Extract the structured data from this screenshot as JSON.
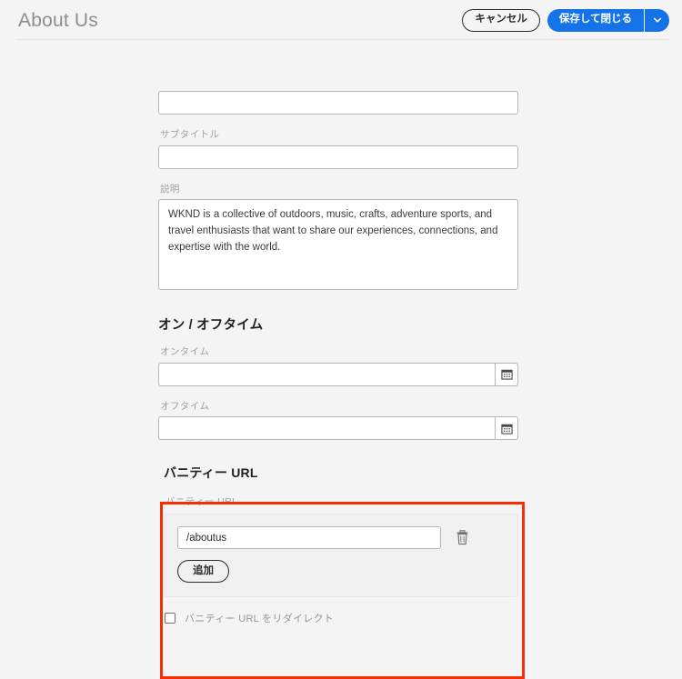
{
  "header": {
    "title": "About Us",
    "cancel_label": "キャンセル",
    "save_label": "保存して閉じる",
    "caret_icon": "chevron-down-icon",
    "accent_color": "#1473e6"
  },
  "form": {
    "title_field": {
      "label": "",
      "value": "",
      "placeholder": ""
    },
    "subtitle_field": {
      "label": "サブタイトル",
      "value": "",
      "placeholder": ""
    },
    "description_field": {
      "label": "説明",
      "value": "WKND is a collective of outdoors, music, crafts, adventure sports, and travel enthusiasts that want to share our experiences, connections, and expertise with the world."
    },
    "ontime_offtime_section": {
      "heading": "オン / オフタイム",
      "ontime": {
        "label": "オンタイム",
        "value": "",
        "placeholder": "",
        "icon": "calendar-icon"
      },
      "offtime": {
        "label": "オフタイム",
        "value": "",
        "placeholder": "",
        "icon": "calendar-icon"
      }
    }
  },
  "vanity_url": {
    "heading": "バニティー URL",
    "label": "バニティー URL",
    "value": "/aboutus",
    "placeholder": "",
    "delete_icon": "trash-icon",
    "add_label": "追加",
    "redirect_checkbox_label": "バニティー URL をリダイレクト",
    "redirect_checked": false,
    "highlight_color": "#f72e05"
  }
}
